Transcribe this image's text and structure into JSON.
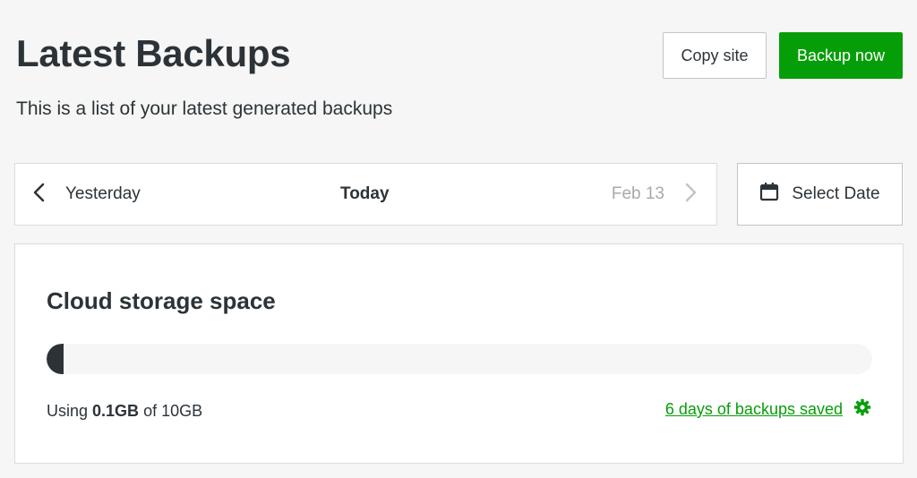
{
  "header": {
    "title": "Latest Backups",
    "subtitle": "This is a list of your latest generated backups",
    "copy_site_label": "Copy site",
    "backup_now_label": "Backup now"
  },
  "date_nav": {
    "prev_label": "Yesterday",
    "current_label": "Today",
    "next_label": "Feb 13",
    "prev_icon": "chevron-left-icon",
    "next_icon": "chevron-right-icon"
  },
  "select_date": {
    "label": "Select Date",
    "icon": "calendar-icon"
  },
  "storage": {
    "title": "Cloud storage space",
    "usage_prefix": "Using ",
    "used": "0.1GB",
    "usage_suffix": " of 10GB",
    "progress_fraction": 0.01,
    "backups_saved_label": "6 days of backups saved",
    "settings_icon": "gear-icon"
  },
  "colors": {
    "accent_green": "#069e08",
    "text_dark": "#2c3338",
    "muted": "#a7aaad",
    "background": "#f5f6f5"
  }
}
